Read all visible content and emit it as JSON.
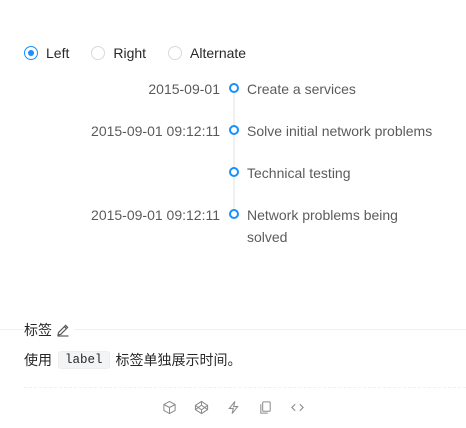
{
  "mode_options": [
    {
      "label": "Left",
      "checked": true
    },
    {
      "label": "Right",
      "checked": false
    },
    {
      "label": "Alternate",
      "checked": false
    }
  ],
  "timeline": [
    {
      "label": "2015-09-01",
      "content": "Create a services"
    },
    {
      "label": "2015-09-01 09:12:11",
      "content": "Solve initial network problems"
    },
    {
      "label": "",
      "content": "Technical testing"
    },
    {
      "label": "2015-09-01 09:12:11",
      "content": "Network problems being solved"
    }
  ],
  "section": {
    "title": "标签",
    "desc_before": "使用",
    "desc_code": "label",
    "desc_after": "标签单独展示时间。"
  },
  "actions": [
    "codesandbox-icon",
    "codepen-icon",
    "stackblitz-icon",
    "copy-icon",
    "code-icon"
  ],
  "colors": {
    "accent": "#1890ff",
    "muted": "#8c8c8c"
  }
}
